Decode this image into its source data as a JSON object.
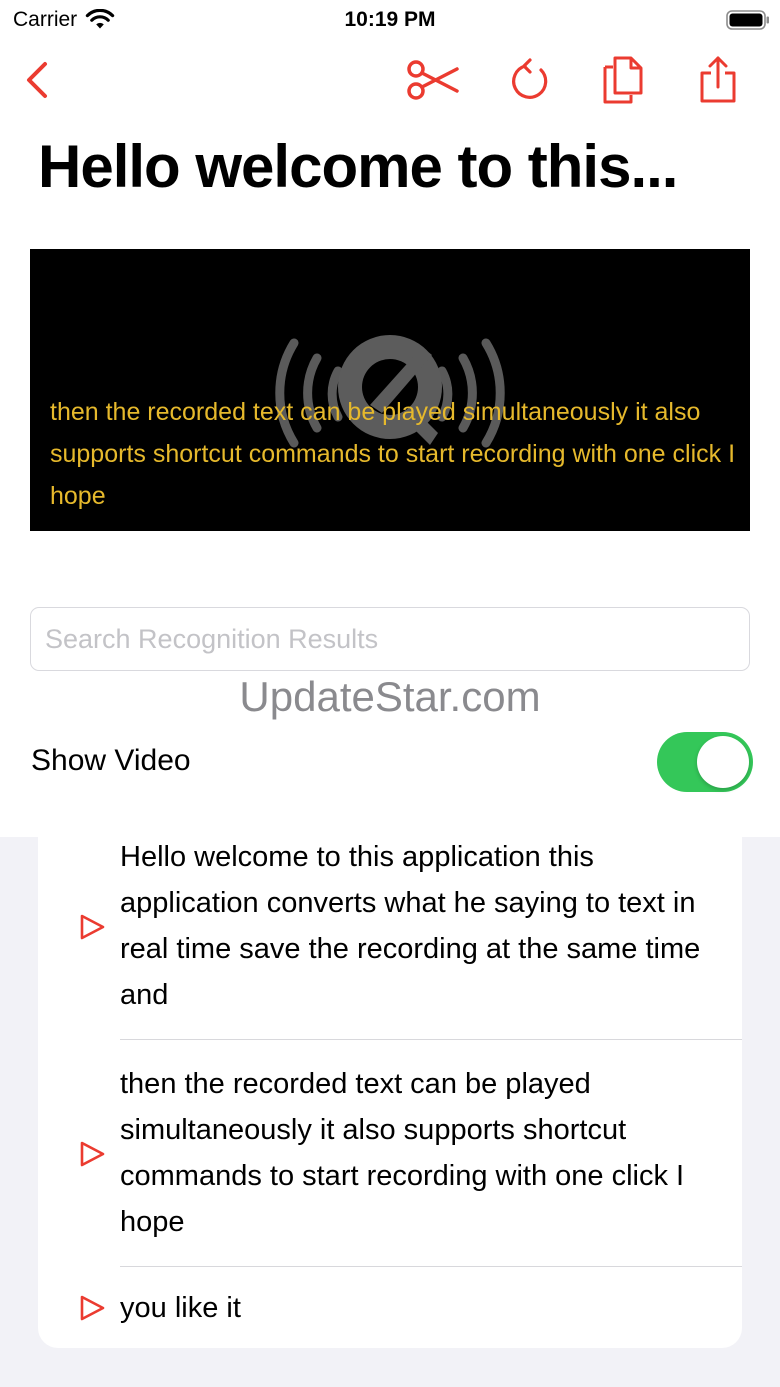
{
  "status_bar": {
    "carrier": "Carrier",
    "time": "10:19 PM"
  },
  "toolbar": {
    "back_icon": "chevron-left-icon",
    "tools": [
      "scissors-icon",
      "undo-icon",
      "copy-icon",
      "share-icon"
    ]
  },
  "page": {
    "title": "Hello welcome to this..."
  },
  "video": {
    "subtitle": "then the recorded text can be played simultaneously it also supports shortcut commands to start recording with one click I hope"
  },
  "search": {
    "placeholder": "Search Recognition Results"
  },
  "watermark": "UpdateStar.com",
  "show_video": {
    "label": "Show Video",
    "on": true
  },
  "results": [
    {
      "text": "Hello welcome to this application this application converts what he saying to text in real time save the recording at the same time and"
    },
    {
      "text": "then the recorded text can be played simultaneously it also supports shortcut commands to start recording with one click I hope"
    },
    {
      "text": "you like it"
    }
  ],
  "colors": {
    "accent": "#eb3b30",
    "subtitle": "#e6b92c",
    "toggle_on": "#34c759",
    "grouped_bg": "#f2f2f7"
  }
}
